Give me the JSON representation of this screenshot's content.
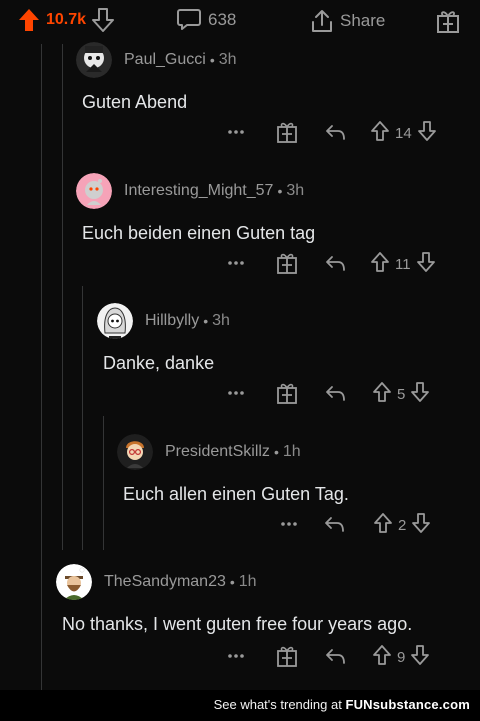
{
  "topbar": {
    "vote_count": "10.7k",
    "comment_count": "638",
    "share_label": "Share"
  },
  "comments": [
    {
      "author": "Paul_Gucci",
      "age": "3h",
      "body": "Guten Abend",
      "score": "14"
    },
    {
      "author": "Interesting_Might_57",
      "age": "3h",
      "body": "Euch beiden einen Guten tag",
      "score": "11"
    },
    {
      "author": "Hillbylly",
      "age": "3h",
      "body": "Danke, danke",
      "score": "5"
    },
    {
      "author": "PresidentSkillz",
      "age": "1h",
      "body": "Euch allen einen Guten Tag.",
      "score": "2"
    },
    {
      "author": "TheSandyman23",
      "age": "1h",
      "body": "No thanks, I went guten free four years ago.",
      "score": "9"
    }
  ],
  "icons": {
    "upvote_active": "upvote-arrow-icon",
    "downvote": "downvote-arrow-icon",
    "comment": "speech-bubble-icon",
    "share": "share-arrow-icon",
    "award": "gift-award-icon",
    "more": "more-dots-icon",
    "reply": "reply-arrow-icon"
  },
  "colors": {
    "accent": "#ff4500",
    "background": "#0b0b0b"
  },
  "footer": {
    "prefix": "See what's trending at",
    "brand": "FUNsubstance.com"
  }
}
